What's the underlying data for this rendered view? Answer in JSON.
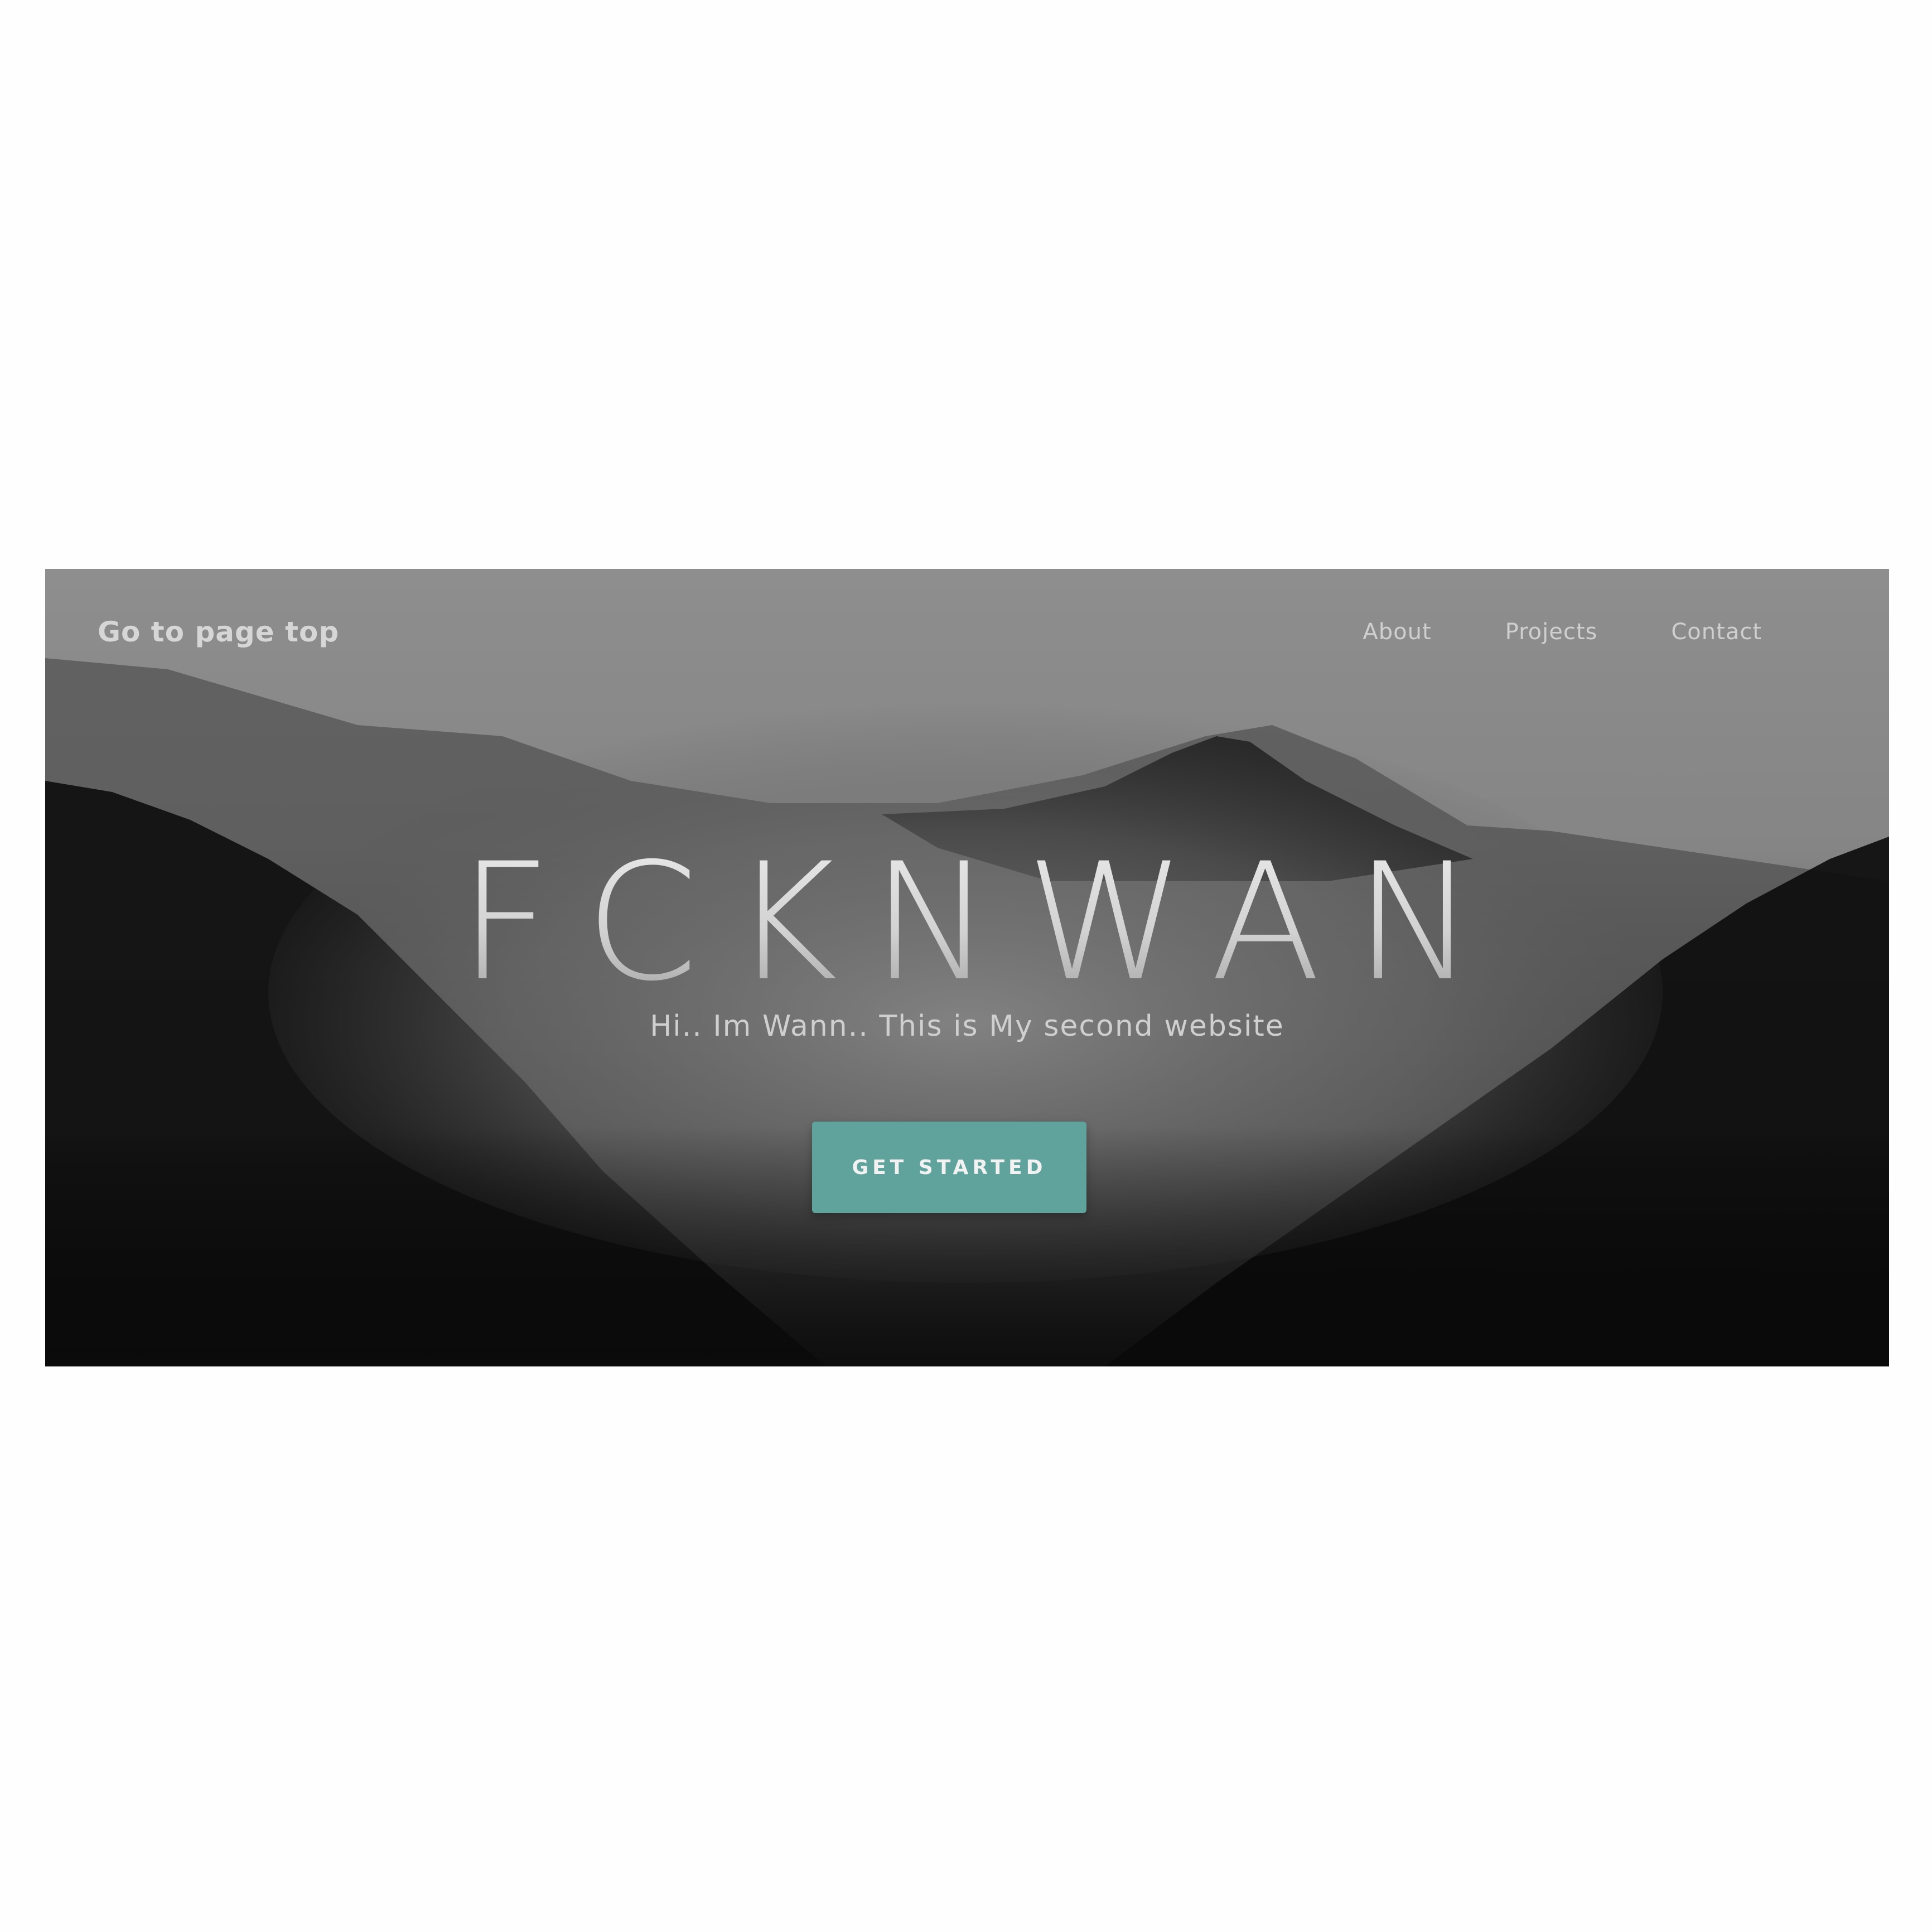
{
  "nav": {
    "brand": "Go to page top",
    "links": [
      "About",
      "Projects",
      "Contact"
    ]
  },
  "hero": {
    "title": "FCKNWAN",
    "subtitle": "Hi.. Im Wann.. This is My second website",
    "cta_label": "GET STARTED",
    "background": "misty-mountain-forest-grayscale"
  },
  "colors": {
    "accent": "#5fa39c",
    "page_background": "#fefefe"
  }
}
